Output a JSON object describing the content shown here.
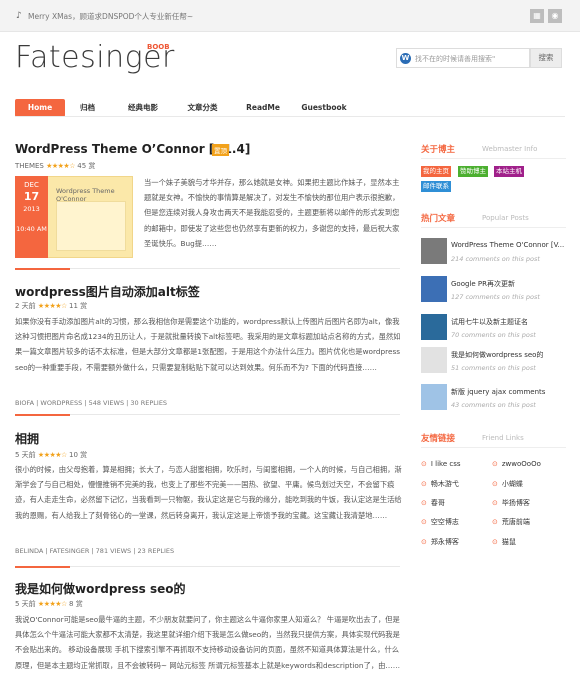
{
  "topbar": {
    "message_prefix": "Merry XMas",
    "message": "，顾道求DNSPOD个人专业新任帮~",
    "icons": [
      "grid-icon",
      "rss-icon"
    ]
  },
  "header": {
    "logo": "Fatesinger",
    "logo_sup": "BOOB",
    "search_placeholder": "找不在的时候请善用搜索\"",
    "search_button": "搜索"
  },
  "nav": {
    "items": [
      "Home",
      "归档",
      "经典电影",
      "文章分类",
      "ReadMe",
      "Guestbook"
    ]
  },
  "posts": [
    {
      "title": "WordPress Theme O’Connor [V1.4]",
      "badge": "置顶",
      "meta_prefix": "THEMES",
      "stars": "★★★★☆",
      "meta_count": "45 赏",
      "thumb": {
        "caption": "Wordpress Theme O'Connor",
        "month": "DEC",
        "day": "17",
        "year": "2013",
        "time": "10:40 AM"
      },
      "excerpt": "当一个妹子美貌与才华并存，那么她就是女神。如果把主题比作妹子，显然本主题就是女神。不愉快的事情算是解决了，对发生不愉快的那位用户表示很抱歉，但是您连续对我人身攻击两天不是我能忍受的，主题更新将以邮件的形式发到您的邮箱中，即使发了这些您也仍然享有更新的权力，多谢您的支持，最后祝大家圣诞快乐。Bug提……"
    },
    {
      "title": "wordpress图片自动添加alt标签",
      "meta_prefix": "2 天前",
      "stars": "★★★★☆",
      "meta_count": "11 赏",
      "excerpt": "如果你没有手动添加图片alt的习惯，那么我相信你是需要这个功能的，wordpress默认上传图片后图片名即为alt，像我这种习惯把图片命名成1234的丑历让人，于是就批量转换下alt标签吧。我采用的是文章标题加站点名称的方式，虽然如果一篇文章图片较多的话不太标准，但是大部分文章都是1张配图，于是用这个办法什么压力。图片优化也是wordpress seo的一种重要手段，不需要额外做什么，只需要复制粘贴下就可以达到效果。何乐而不为? 下面的代码直接……",
      "footer": "BIOFA | WORDPRESS | 548 VIEWS | 30 REPLIES"
    },
    {
      "title": "相拥",
      "meta_prefix": "5 天前",
      "stars": "★★★★☆",
      "meta_count": "10 赏",
      "excerpt": "很小的时候，由父母抱着，算是相拥；长大了，与恋人甜蜜相拥，吹乐时，与闺蜜相拥，一个人的时候，与自己相拥，渐渐学会了与自己相处，慢慢推销不完美的我，也变上了那些不完美——国热、欲望、平庸。候鸟划过天空，不会留下痕迹，有人走走生命，必然留下记忆，当我看到一只物躯，我认定这是它与我的缘分，能吃到我的牛饭，我认定这是生活给我的恩赐，有人给我上了刻骨铭心的一堂课，然后转身离开，我认定这是上帝馈予我的宝藏。这宝藏让我清楚地……",
      "footer": "BELINDA | FATESINGER | 781 VIEWS | 23 REPLIES"
    },
    {
      "title": "我是如何做wordpress seo的",
      "meta_prefix": "5 天前",
      "stars": "★★★★☆",
      "meta_count": "8 赏",
      "excerpt": "我说O'Connor可能是seo最牛逼的主题，不少朋友就要问了，你主题这么牛逼你家里人知道么？ 牛逼是吹出去了，但是具体怎么个牛逼法可能大家都不太清楚，我这里就详细介绍下我是怎么做seo的，当然我只提供方案，具体实现代码我是不会贴出来的。 移动设备展现 手机下搜索引擎不再抓取不支持移动设备访问的页面，虽然不知道具体算法是什么，什么原理，但是本主题均正常抓取，且不会被转码~ 网站元标签 所谓元标签基本上就是keywords和description了，由……"
    }
  ],
  "sidebar": {
    "about": {
      "title": "关于博主",
      "subtitle": "Webmaster Info",
      "tags": [
        "我的主页",
        "赞助博主",
        "本站主机",
        "邮件联系"
      ],
      "tag_colors": [
        "#f4663f",
        "#4caf30",
        "#a0208a",
        "#2f8fd6"
      ]
    },
    "popular": {
      "title": "热门文章",
      "subtitle": "Popular Posts",
      "items": [
        {
          "title": "WordPress Theme O'Connor [V...",
          "meta": "214 comments on this post",
          "icon": "avatar-thumb"
        },
        {
          "title": "Google PR再次更新",
          "meta": "127 comments on this post",
          "icon": "google-thumb"
        },
        {
          "title": "试用七牛以及新主题证名",
          "meta": "70 comments on this post",
          "icon": "twitter-thumb"
        },
        {
          "title": "我是如何做wordpress seo的",
          "meta": "51 comments on this post",
          "icon": "seo-thumb"
        },
        {
          "title": "新版 jquery ajax comments",
          "meta": "43 comments on this post",
          "icon": "ajax-thumb"
        }
      ]
    },
    "links": {
      "title": "友情链接",
      "subtitle": "Friend Links",
      "items": [
        "I like css",
        "zwwoOoOo",
        "畅木游弋",
        "小蝴蝶",
        "春哥",
        "毕扬博客",
        "空空博志",
        "荒唐前端",
        "郑永博客",
        "猫鼠"
      ]
    }
  }
}
